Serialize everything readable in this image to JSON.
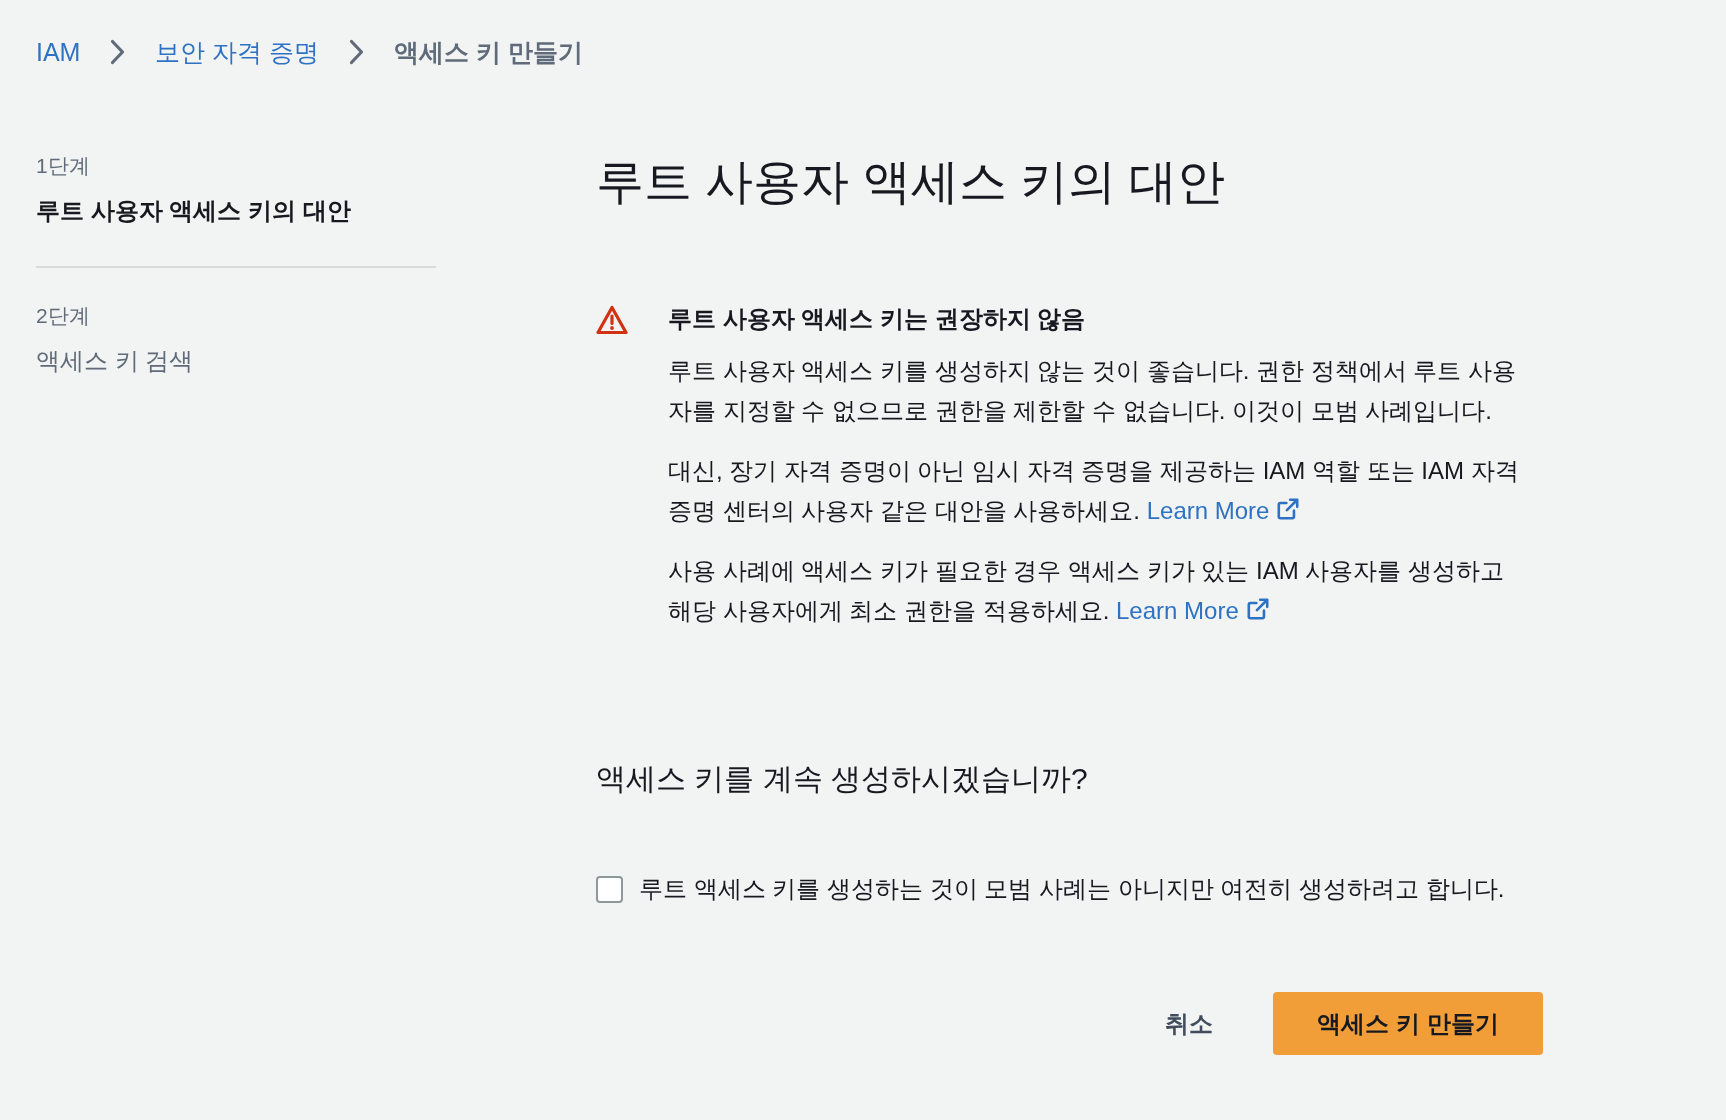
{
  "breadcrumb": [
    {
      "label": "IAM",
      "kind": "link"
    },
    {
      "label": "보안 자격 증명",
      "kind": "link"
    },
    {
      "label": "액세스 키 만들기",
      "kind": "current"
    }
  ],
  "steps": [
    {
      "step": "1단계",
      "title": "루트 사용자 액세스 키의 대안",
      "selected": true
    },
    {
      "step": "2단계",
      "title": "액세스 키 검색",
      "selected": false
    }
  ],
  "title": "루트 사용자 액세스 키의 대안",
  "alert": {
    "heading": "루트 사용자 액세스 키는 권장하지 않음",
    "paragraphs": [
      {
        "text": "루트 사용자 액세스 키를 생성하지 않는 것이 좋습니다. 권한 정책에서 루트 사용자를 지정할 수 없으므로 권한을 제한할 수 없습니다. 이것이 모범 사례입니다."
      },
      {
        "text": "대신, 장기 자격 증명이 아닌 임시 자격 증명을 제공하는 IAM 역할 또는 IAM 자격 증명 센터의 사용자 같은 대안을 사용하세요.",
        "link": "Learn More"
      },
      {
        "text": "사용 사례에 액세스 키가 필요한 경우 액세스 키가 있는 IAM 사용자를 생성하고 해당 사용자에게 최소 권한을 적용하세요.",
        "link": "Learn More"
      }
    ]
  },
  "question": "액세스 키를 계속 생성하시겠습니까?",
  "confirm": {
    "label": "루트 액세스 키를 생성하는 것이 모범 사례는 아니지만 여전히 생성하려고 합니다.",
    "checked": false
  },
  "buttons": [
    {
      "label": "취소",
      "kind": "link"
    },
    {
      "label": "액세스 키 만들기",
      "kind": "primary"
    }
  ]
}
